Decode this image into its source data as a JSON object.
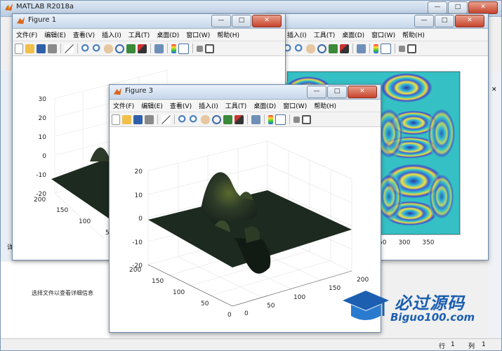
{
  "main_window": {
    "title": "MATLAB R2018a",
    "status_row_label": "行",
    "status_row_value": "1",
    "status_col_label": "列",
    "status_col_value": "1",
    "details_text": "选择文件以查看详细信息",
    "side_tab_char": "详"
  },
  "menu_items": [
    "文件(F)",
    "编辑(E)",
    "查看(V)",
    "插入(I)",
    "工具(T)",
    "桌面(D)",
    "窗口(W)",
    "帮助(H)"
  ],
  "figures": {
    "figure1": {
      "title": "Figure 1",
      "z_ticks": [
        "30",
        "20",
        "10",
        "0",
        "-10",
        "-20"
      ],
      "y_ticks": [
        "200",
        "150",
        "100",
        "5"
      ]
    },
    "figure2": {
      "x_ticks": "50 300 350"
    },
    "figure3": {
      "title": "Figure 3",
      "z_ticks": [
        "20",
        "10",
        "0",
        "-10",
        "-20"
      ],
      "y_ticks": [
        "200",
        "150",
        "100",
        "50",
        "0"
      ],
      "x_ticks": [
        "0",
        "50",
        "100",
        "150",
        "200"
      ]
    }
  },
  "watermark": {
    "cn": "必过源码",
    "en": "Biguo100.com"
  },
  "colors": {
    "surface_dark": "#1d2a1f",
    "contour_bg": "#32c0c5",
    "title_gradient_top": "#e9f1fa"
  }
}
